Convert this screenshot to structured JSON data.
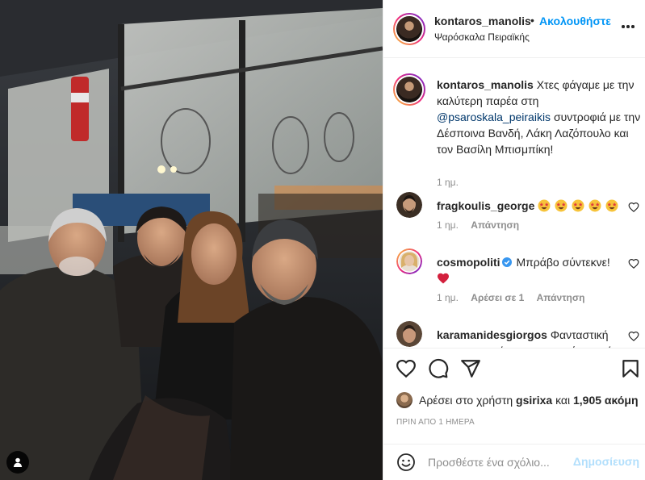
{
  "header": {
    "username": "kontaros_manolis",
    "separator": "•",
    "follow_label": "Ακολουθήστε",
    "location": "Ψαρόσκαλα Πειραϊκής",
    "more_icon": "more-horizontal-icon"
  },
  "caption": {
    "username": "kontaros_manolis",
    "text_before": "Χτες φάγαμε με την καλύτερη παρέα στη",
    "mention": "@psaroskala_peiraikis",
    "text_after": "συντροφιά με την Δέσποινα Βανδή, Λάκη Λαζόπουλο και τον Βασίλη Μπισμπίκη!",
    "time": "1 ημ."
  },
  "comments": [
    {
      "username": "fragkoulis_george",
      "text": "",
      "emoji_count": 5,
      "time": "1 ημ.",
      "reply": "Απάντηση",
      "likes": ""
    },
    {
      "username": "cosmopoliti",
      "verified": true,
      "text": "Μπράβο σύντεκνε!",
      "time": "1 ημ.",
      "likes": "Αρέσει σε 1",
      "reply": "Απάντηση"
    },
    {
      "username": "karamanidesgiorgos",
      "text": "Φανταστική παρεα που είστε και φαγητό που είστε",
      "time": "",
      "reply": ""
    }
  ],
  "likes": {
    "prefix": "Αρέσει στο χρήστη",
    "user": "gsirixa",
    "middle": "και",
    "count": "1,905 ακόμη"
  },
  "timestamp": "ΠΡΙΝ ΑΠΟ 1 ΗΜΕΡΑ",
  "add_comment": {
    "placeholder": "Προσθέστε ένα σχόλιο...",
    "post_label": "Δημοσίευση"
  },
  "colors": {
    "link_blue": "#0095f6",
    "mention_blue": "#00376b",
    "muted": "#8e8e8e",
    "post_disabled": "#b2dffc",
    "heart_red": "#ed4956"
  }
}
